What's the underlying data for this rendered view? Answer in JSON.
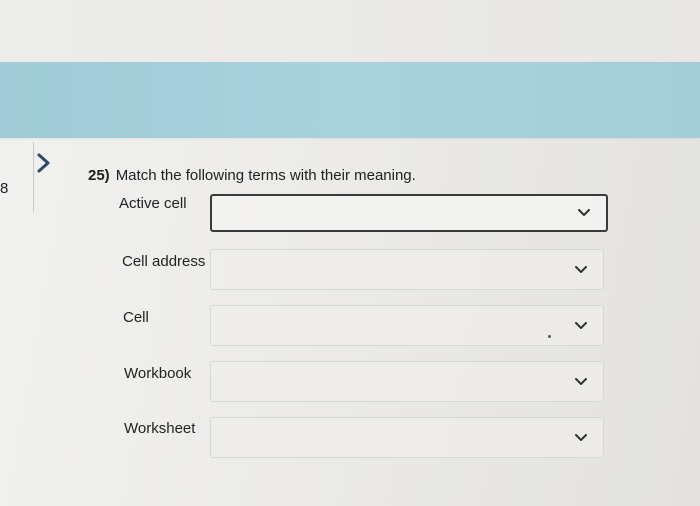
{
  "sidebar": {
    "question_number": "8"
  },
  "question": {
    "number": "25)",
    "text": "Match the following terms with their meaning."
  },
  "rows": [
    {
      "label": "Active cell",
      "selected": ""
    },
    {
      "label": "Cell address",
      "selected": ""
    },
    {
      "label": "Cell",
      "selected": ""
    },
    {
      "label": "Workbook",
      "selected": ""
    },
    {
      "label": "Worksheet",
      "selected": ""
    }
  ],
  "icons": {
    "nav": "chevron-right-icon",
    "dropdown": "chevron-down-icon"
  },
  "colors": {
    "banner": "#a6d0db",
    "background": "#ecebe8",
    "active_border": "#3a3a3a",
    "inactive_border": "#d6d6d3"
  }
}
